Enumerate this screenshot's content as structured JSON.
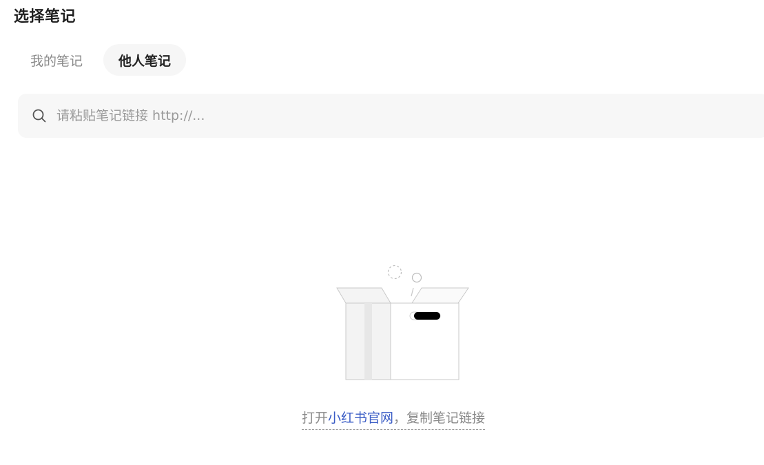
{
  "page": {
    "title": "选择笔记"
  },
  "tabs": [
    {
      "label": "我的笔记",
      "active": false
    },
    {
      "label": "他人笔记",
      "active": true
    }
  ],
  "search": {
    "placeholder": "请粘贴笔记链接 http://...",
    "value": "",
    "icon": "search-icon"
  },
  "empty_state": {
    "illustration": "empty-box-illustration",
    "hint_prefix": "打开",
    "hint_link": "小红书官网",
    "hint_suffix": "，复制笔记链接"
  },
  "colors": {
    "link": "#3a5cc5",
    "muted_text": "#8a8a8a",
    "search_bg": "#f7f7f7",
    "active_tab_bg": "#f6f6f6"
  }
}
